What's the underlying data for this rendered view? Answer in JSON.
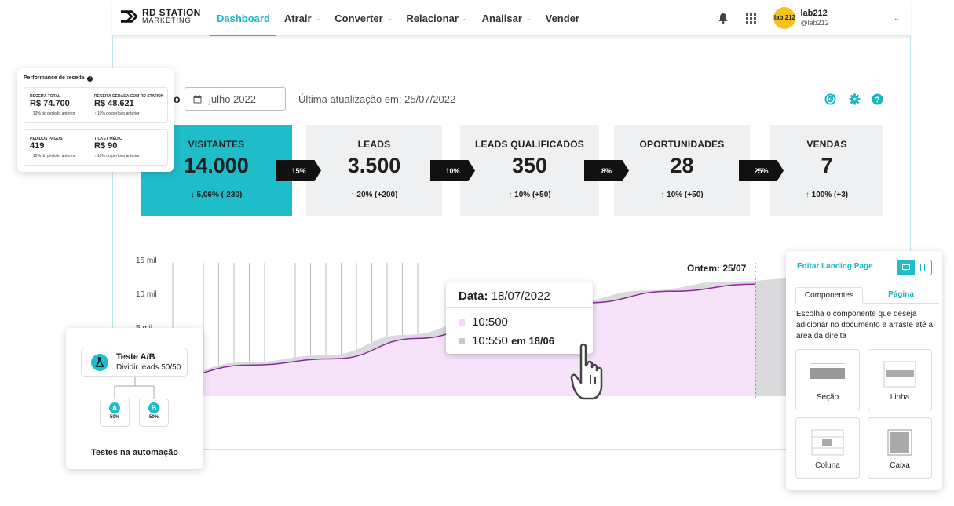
{
  "brand": {
    "line1": "RD STATION",
    "line2": "MARKETING"
  },
  "nav": [
    {
      "label": "Dashboard",
      "active": true,
      "chevron": false
    },
    {
      "label": "Atrair",
      "chevron": true
    },
    {
      "label": "Converter",
      "chevron": true
    },
    {
      "label": "Relacionar",
      "chevron": true
    },
    {
      "label": "Analisar",
      "chevron": true
    },
    {
      "label": "Vender",
      "chevron": false
    }
  ],
  "header_icons": [
    "bell-icon",
    "apps-grid-icon"
  ],
  "user": {
    "avatar_text": "lab 212",
    "name": "lab212",
    "handle": "@lab212"
  },
  "toolbar": {
    "period_prefix": "o",
    "month": "julho 2022",
    "last_update": "Última atualização em: 25/07/2022",
    "icons": [
      "target-icon",
      "gear-icon",
      "help-icon"
    ]
  },
  "funnel": [
    {
      "label": "VISITANTES",
      "value": "14.000",
      "change": "5,06% (-230)",
      "direction": "down"
    },
    {
      "label": "LEADS",
      "value": "3.500",
      "change": "20% (+200)",
      "direction": "up"
    },
    {
      "label": "LEADS QUALIFICADOS",
      "value": "350",
      "change": "10% (+50)",
      "direction": "up"
    },
    {
      "label": "OPORTUNIDADES",
      "value": "28",
      "change": "10% (+50)",
      "direction": "up"
    },
    {
      "label": "VENDAS",
      "value": "7",
      "change": "100% (+3)",
      "direction": "up"
    }
  ],
  "conversions": [
    "15%",
    "10%",
    "8%",
    "25%"
  ],
  "chart": {
    "y_ticks": [
      "15 mil",
      "10 mil",
      "5 mil"
    ],
    "marker": "Ontem: 25/07",
    "tooltip": {
      "date_label": "Data:",
      "date": "18/07/2022",
      "current": "10:500",
      "previous": "10:550",
      "previous_suffix": "em 18/06"
    },
    "colors": {
      "current_fill": "#f6e3fa",
      "current_line": "#8b2a9a",
      "previous_fill": "#d9dadc"
    }
  },
  "chart_data": {
    "type": "area",
    "ylim": [
      0,
      15000
    ],
    "y_ticks": [
      "15 mil",
      "10 mil",
      "5 mil"
    ],
    "series": [
      {
        "values": [
          2000,
          3500,
          4200,
          6500,
          8800,
          10500,
          11800,
          12600
        ]
      },
      {
        "values": [
          2100,
          3800,
          4600,
          6900,
          9000,
          10550,
          11900,
          12900,
          13300
        ]
      }
    ]
  },
  "revenue_card": {
    "title": "Performance de receita",
    "metrics": [
      {
        "label": "RECEITA TOTAL",
        "value": "R$ 74.700",
        "note": "10% do período anterior"
      },
      {
        "label": "RECEITA GERADA COM RD STATION",
        "value": "R$ 48.621",
        "note": "10% do período anterior"
      },
      {
        "label": "PEDIDOS PAGOS",
        "value": "419",
        "note": "10% do período anterior"
      },
      {
        "label": "TICKET MÉDIO",
        "value": "R$ 90",
        "note": "10% do período anterior"
      }
    ]
  },
  "ab_card": {
    "title": "Teste A/B",
    "subtitle": "Dividir leads 50/50",
    "branches": [
      {
        "letter": "A",
        "pct": "50%"
      },
      {
        "letter": "B",
        "pct": "50%"
      }
    ],
    "footer": "Testes na automação"
  },
  "landing_card": {
    "title": "Editar Landing Page",
    "tabs": [
      "Componentes",
      "Página"
    ],
    "description": "Escolha o componente que deseja adicionar no documento e arraste até a área da direita",
    "components": [
      "Seção",
      "Linha",
      "Coluna",
      "Caixa"
    ]
  }
}
